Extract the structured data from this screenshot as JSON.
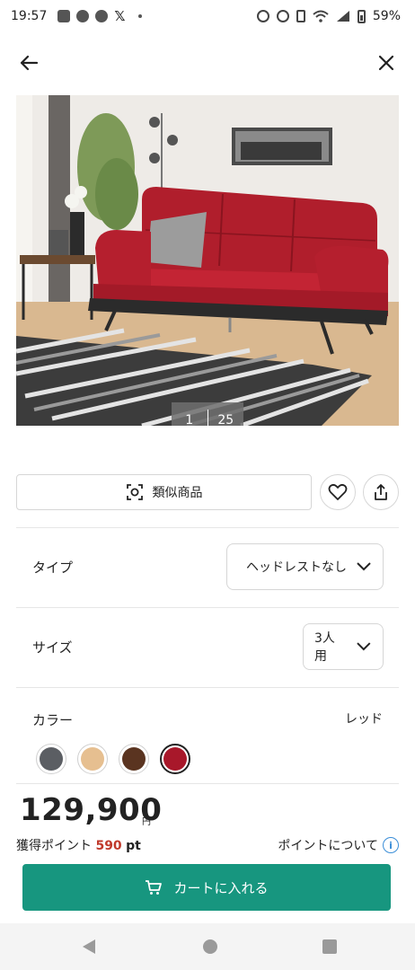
{
  "status_bar": {
    "time": "19:57",
    "battery": "59%"
  },
  "product": {
    "image_index": "1",
    "image_total": "25"
  },
  "actions": {
    "similar_label": "類似商品"
  },
  "options": {
    "type": {
      "label": "タイプ",
      "value": "ヘッドレストなし"
    },
    "size": {
      "label": "サイズ",
      "value": "3人用"
    },
    "color": {
      "label": "カラー",
      "value": "レッド",
      "swatches": [
        "#5b5e63",
        "#e6bf90",
        "#5a3420",
        "#a8182a"
      ],
      "selected_index": 3
    }
  },
  "price": {
    "amount": "129,900",
    "currency": "円"
  },
  "points": {
    "label": "獲得ポイント",
    "value": "590",
    "unit": "pt",
    "about_label": "ポイントについて"
  },
  "cart": {
    "label": "カートに入れる"
  },
  "colors": {
    "accent": "#17967f",
    "point_red": "#c0392b",
    "info_blue": "#3b8ed8"
  }
}
